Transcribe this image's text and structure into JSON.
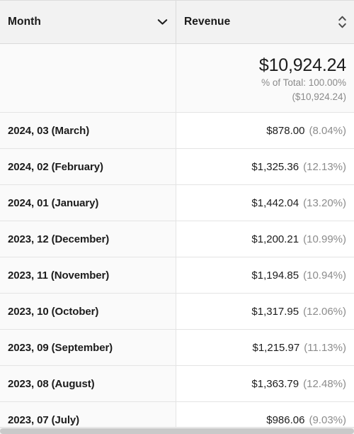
{
  "table": {
    "columns": [
      {
        "key": "month",
        "label": "Month",
        "sort_icon": "chevron-down-icon",
        "sort_state": "descending"
      },
      {
        "key": "revenue",
        "label": "Revenue",
        "sort_icon": "sort-updown-icon",
        "sort_state": "unsorted"
      }
    ],
    "summary": {
      "month": "",
      "total": "$10,924.24",
      "percent_of_total_label": "% of Total: 100.00%",
      "total_parenthetical": "($10,924.24)"
    },
    "rows": [
      {
        "month": "2024, 03 (March)",
        "amount": "$878.00",
        "percent": "(8.04%)"
      },
      {
        "month": "2024, 02 (February)",
        "amount": "$1,325.36",
        "percent": "(12.13%)"
      },
      {
        "month": "2024, 01 (January)",
        "amount": "$1,442.04",
        "percent": "(13.20%)"
      },
      {
        "month": "2023, 12 (December)",
        "amount": "$1,200.21",
        "percent": "(10.99%)"
      },
      {
        "month": "2023, 11 (November)",
        "amount": "$1,194.85",
        "percent": "(10.94%)"
      },
      {
        "month": "2023, 10 (October)",
        "amount": "$1,317.95",
        "percent": "(12.06%)"
      },
      {
        "month": "2023, 09 (September)",
        "amount": "$1,215.97",
        "percent": "(11.13%)"
      },
      {
        "month": "2023, 08 (August)",
        "amount": "$1,363.79",
        "percent": "(12.48%)"
      },
      {
        "month": "2023, 07 (July)",
        "amount": "$986.06",
        "percent": "(9.03%)"
      }
    ]
  },
  "chart_data": {
    "type": "table",
    "title": "",
    "columns": [
      "Month",
      "Revenue"
    ],
    "categories": [
      "2024, 03 (March)",
      "2024, 02 (February)",
      "2024, 01 (January)",
      "2023, 12 (December)",
      "2023, 11 (November)",
      "2023, 10 (October)",
      "2023, 09 (September)",
      "2023, 08 (August)",
      "2023, 07 (July)"
    ],
    "series": [
      {
        "name": "Revenue",
        "values": [
          878.0,
          1325.36,
          1442.04,
          1200.21,
          1194.85,
          1317.95,
          1215.97,
          1363.79,
          986.06
        ]
      },
      {
        "name": "% of Total",
        "values": [
          8.04,
          12.13,
          13.2,
          10.99,
          10.94,
          12.06,
          11.13,
          12.48,
          9.03
        ]
      }
    ],
    "total": 10924.24,
    "total_percent": 100.0,
    "currency": "USD",
    "sort": {
      "column": "Month",
      "direction": "descending"
    }
  },
  "colors": {
    "header_bg": "#f2f2f2",
    "row_alt_bg": "#fafafa",
    "row_bg": "#ffffff",
    "border": "#e4e4e4",
    "text": "#1c1c1c",
    "muted_text": "#8c8c8c",
    "scrollbar_thumb": "#c9c9c9"
  },
  "scrollbar": {
    "orientation": "horizontal",
    "thumb_width_pct": 100
  }
}
